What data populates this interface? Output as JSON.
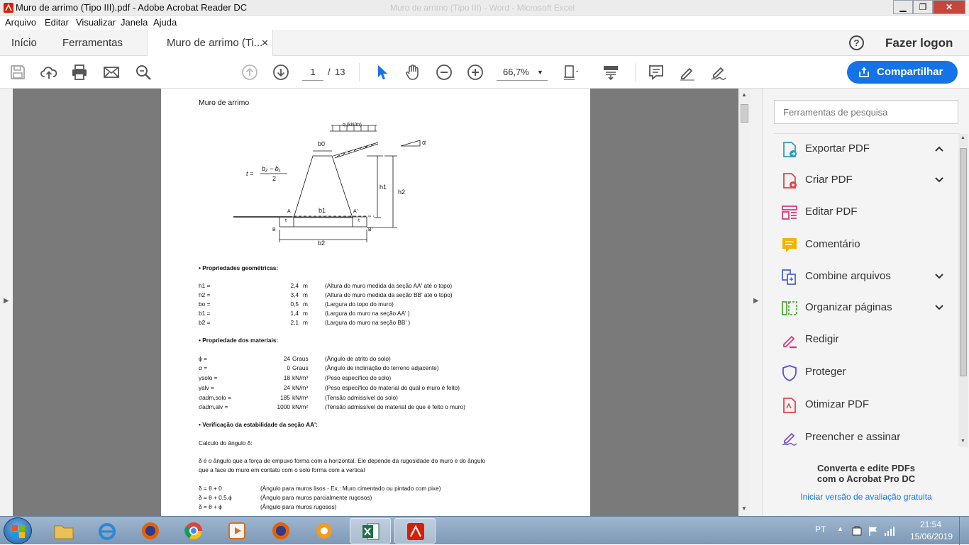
{
  "window": {
    "title": "Muro de arrimo (Tipo III).pdf - Adobe Acrobat Reader DC",
    "ghost_title": "Muro de arrimo (Tipo III) - Word - Microsoft Excel"
  },
  "menu": [
    "Arquivo",
    "Editar",
    "Visualizar",
    "Janela",
    "Ajuda"
  ],
  "tabs": {
    "home": "Início",
    "tools": "Ferramentas",
    "doc": "Muro de arrimo (Ti..."
  },
  "header": {
    "login": "Fazer logon",
    "help_icon": "?"
  },
  "toolbar": {
    "page_current": "1",
    "page_sep": "/",
    "page_total": "13",
    "zoom": "66,7%",
    "share": "Compartilhar"
  },
  "document": {
    "heading": "Muro de arrimo",
    "diagram": {
      "q": "q (kN/m)",
      "alpha": "α",
      "b0": "b0",
      "b1": "b1",
      "b2": "b2",
      "h1": "h1",
      "h2": "h2",
      "A": "A",
      "A2": "A'",
      "B": "B",
      "B2": "B'",
      "t1": "t",
      "t2": "t",
      "formula_lhs": "t =",
      "formula_num": "b₂ − b₁",
      "formula_den": "2"
    },
    "sec_geo": "• Propriedades geométricas:",
    "geo": [
      {
        "k": "h1 =",
        "v": "2,4",
        "u": "m",
        "d": "(Altura do muro medida da seção AA' até o topo)"
      },
      {
        "k": "h2 =",
        "v": "3,4",
        "u": "m",
        "d": "(Altura do muro medida da seção BB' até o topo)"
      },
      {
        "k": "bo =",
        "v": "0,5",
        "u": "m",
        "d": "(Largura do topo do muro)"
      },
      {
        "k": "b1 =",
        "v": "1,4",
        "u": "m",
        "d": "(Largura do muro na seção AA' )"
      },
      {
        "k": "b2 =",
        "v": "2,1",
        "u": "m",
        "d": "(Largura do muro na seção BB' )"
      }
    ],
    "sec_mat": "• Propriedade dos materiais:",
    "mat": [
      {
        "k": "ϕ =",
        "v": "24",
        "u": "Graus",
        "d": "(Ângulo de atrito do solo)"
      },
      {
        "k": "α =",
        "v": "0",
        "u": "Graus",
        "d": "(Ângulo de inclinação do terreno adjacente)"
      },
      {
        "k": "γsolo =",
        "v": "18",
        "u": "kN/m³",
        "d": "(Peso específico do solo)"
      },
      {
        "k": "γalv =",
        "v": "24",
        "u": "kN/m³",
        "d": "(Peso específico do material do qual o muro é feito)"
      },
      {
        "k": "σadm,solo =",
        "v": "185",
        "u": "kN/m²",
        "d": "(Tensão admissível do solo)"
      },
      {
        "k": "σadm,alv =",
        "v": "1000",
        "u": "kN/m²",
        "d": "(Tensão admissível do material de que é feito o muro)"
      }
    ],
    "sec_ver": "• Verificação da estabilidade da seção AA':",
    "calc": "Calculo do ângulo δ:",
    "para1": "δ é o ângulo que a força de empuxo forma com a horizontal. Ele depende da rugosidade do muro e do ângulo",
    "para2": "que a face do muro em contato com o solo forma com a vertical",
    "cases": [
      {
        "k": "δ = θ + 0",
        "d": "(Ângulo para muros lisos - Ex.: Muro cimentado ou pintado com pixe)"
      },
      {
        "k": "δ = θ + 0,5.ϕ",
        "d": "(Ângulo para muros parcialmente rugosos)"
      },
      {
        "k": "δ = θ + ϕ",
        "d": "(Ângulo para muros rugosos)"
      }
    ]
  },
  "right_panel": {
    "search_placeholder": "Ferramentas de pesquisa",
    "tools": [
      {
        "label": "Exportar PDF",
        "icon": "export-pdf-icon",
        "color": "#2f9bb8"
      },
      {
        "label": "Criar PDF",
        "icon": "create-pdf-icon",
        "color": "#e0454a"
      },
      {
        "label": "Editar PDF",
        "icon": "edit-pdf-icon",
        "color": "#d63c7a"
      },
      {
        "label": "Comentário",
        "icon": "comment-icon",
        "color": "#f2b400"
      },
      {
        "label": "Combine arquivos",
        "icon": "combine-files-icon",
        "color": "#4a64d6"
      },
      {
        "label": "Organizar páginas",
        "icon": "organize-pages-icon",
        "color": "#55a838"
      },
      {
        "label": "Redigir",
        "icon": "redact-icon",
        "color": "#d63c7a"
      },
      {
        "label": "Proteger",
        "icon": "protect-icon",
        "color": "#5b4fd6"
      },
      {
        "label": "Otimizar PDF",
        "icon": "optimize-pdf-icon",
        "color": "#e0454a"
      },
      {
        "label": "Preencher e assinar",
        "icon": "fill-sign-icon",
        "color": "#7b52c9"
      }
    ],
    "promo_line1": "Converta e edite PDFs",
    "promo_line2": "com o Acrobat Pro DC",
    "promo_link": "Iniciar versão de avaliação gratuita"
  },
  "taskbar": {
    "lang": "PT",
    "time": "21:54",
    "date": "15/06/2019"
  },
  "colors": {
    "accent": "#1473e6",
    "doc_bg": "#7a7a7a"
  }
}
